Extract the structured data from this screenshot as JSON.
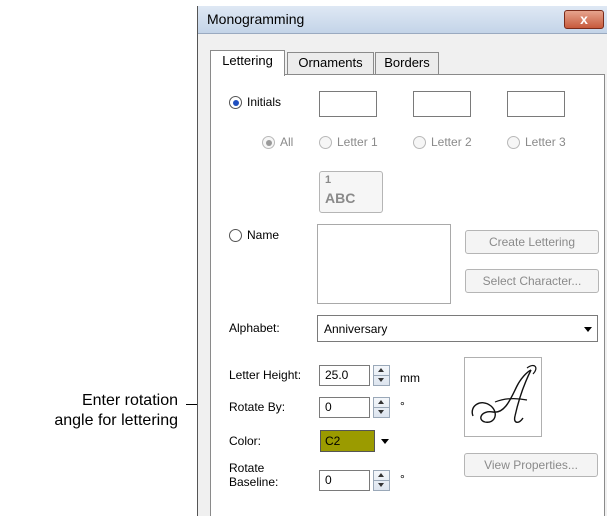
{
  "callout": {
    "text_line1": "Enter rotation",
    "text_line2": "angle for lettering"
  },
  "dialog": {
    "title": "Monogramming",
    "close_label": "x",
    "tabs": [
      {
        "label": "Lettering",
        "active": true
      },
      {
        "label": "Ornaments",
        "active": false
      },
      {
        "label": "Borders",
        "active": false
      }
    ],
    "initials": {
      "label": "Initials",
      "selected": true,
      "scope_options": [
        {
          "label": "All",
          "selected": true,
          "enabled": false
        },
        {
          "label": "Letter 1",
          "selected": false,
          "enabled": false
        },
        {
          "label": "Letter 2",
          "selected": false,
          "enabled": false
        },
        {
          "label": "Letter 3",
          "selected": false,
          "enabled": false
        }
      ],
      "preview_number": "1",
      "preview_text": "ABC"
    },
    "name": {
      "label": "Name",
      "selected": false
    },
    "buttons": {
      "create_lettering": "Create Lettering",
      "select_character": "Select Character...",
      "view_properties": "View Properties..."
    },
    "alphabet": {
      "label": "Alphabet:",
      "value": "Anniversary"
    },
    "letter_height": {
      "label": "Letter Height:",
      "value": "25.0",
      "unit": "mm"
    },
    "rotate_by": {
      "label": "Rotate By:",
      "value": "0",
      "unit": "°"
    },
    "color": {
      "label": "Color:",
      "value": "C2",
      "swatch": "#9b9b00"
    },
    "rotate_baseline": {
      "label_line1": "Rotate",
      "label_line2": "Baseline:",
      "value": "0",
      "unit": "°"
    },
    "sample_glyph": "𝒜"
  }
}
